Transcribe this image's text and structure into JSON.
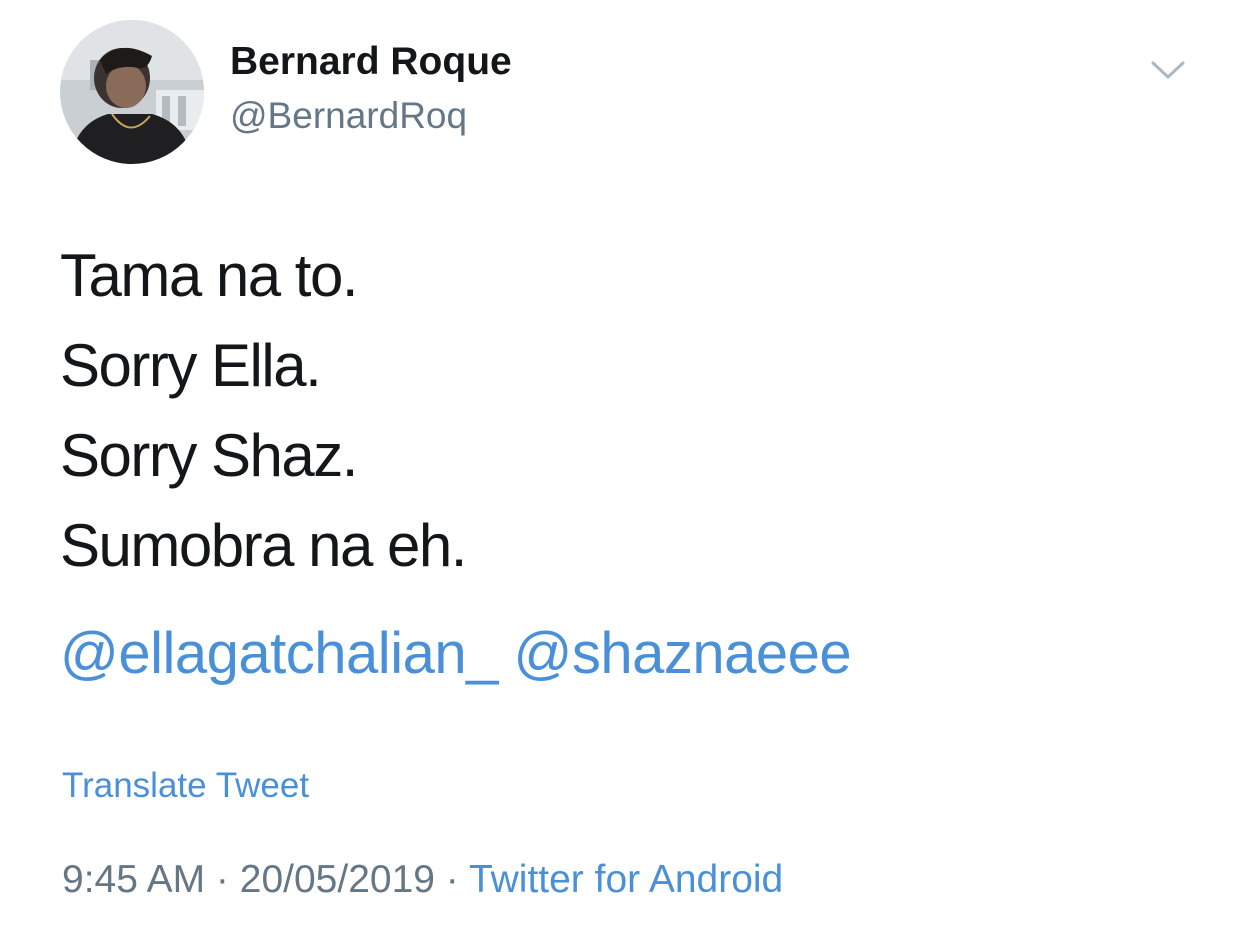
{
  "author": {
    "name": "Bernard Roque",
    "handle": "@BernardRoq"
  },
  "tweet": {
    "lines": [
      "Tama na to.",
      "Sorry Ella.",
      "Sorry Shaz.",
      "Sumobra na eh."
    ],
    "mentions": [
      "@ellagatchalian_",
      "@shaznaeee"
    ],
    "translate_label": "Translate Tweet",
    "time": "9:45 AM",
    "separator": " · ",
    "date": "20/05/2019",
    "source": "Twitter for Android"
  },
  "icons": {
    "menu": "chevron-down-icon",
    "avatar": "profile-photo"
  },
  "colors": {
    "text": "#14171a",
    "secondary": "#657786",
    "link": "#4a90d9",
    "background": "#ffffff"
  }
}
